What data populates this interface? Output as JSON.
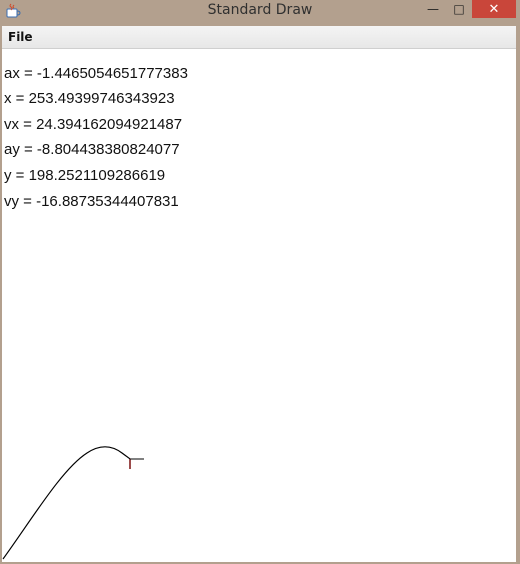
{
  "window": {
    "title": "Standard Draw",
    "controls": {
      "minimize": "—",
      "maximize": "□",
      "close": "✕"
    }
  },
  "menu": {
    "file": "File"
  },
  "readout": {
    "ax": "ax = -1.4465054651777383",
    "x": "x = 253.49399746343923",
    "vx": "vx = 24.394162094921487",
    "ay": "ay = -8.804438380824077",
    "y": "y = 198.2521109286619",
    "vy": "vy = -16.88735344407831"
  },
  "colors": {
    "accent_close": "#c9463a",
    "trajectory": "#000000",
    "marker": "#7a1010"
  },
  "icons": {
    "app": "java-icon"
  }
}
